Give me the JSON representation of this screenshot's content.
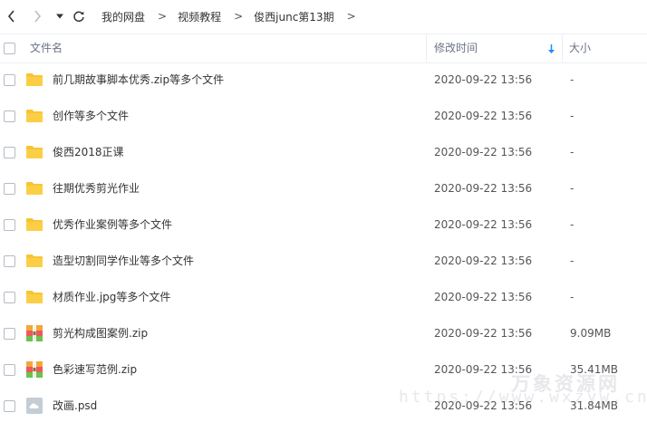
{
  "breadcrumb": [
    "我的网盘",
    "视频教程",
    "俊西junc第13期"
  ],
  "header": {
    "name": "文件名",
    "modified": "修改时间",
    "size": "大小"
  },
  "colors": {
    "folder": "#f9c433",
    "zip": "multicolor",
    "psd": "#c4ccd6",
    "sort_arrow": "#1a8cff"
  },
  "files": [
    {
      "name": "前几期故事脚本优秀.zip等多个文件",
      "time": "2020-09-22 13:56",
      "size": "-",
      "type": "folder",
      "icon": "folder-icon"
    },
    {
      "name": "创作等多个文件",
      "time": "2020-09-22 13:56",
      "size": "-",
      "type": "folder",
      "icon": "folder-icon"
    },
    {
      "name": "俊西2018正课",
      "time": "2020-09-22 13:56",
      "size": "-",
      "type": "folder",
      "icon": "folder-icon"
    },
    {
      "name": "往期优秀剪光作业",
      "time": "2020-09-22 13:56",
      "size": "-",
      "type": "folder",
      "icon": "folder-icon"
    },
    {
      "name": "优秀作业案例等多个文件",
      "time": "2020-09-22 13:56",
      "size": "-",
      "type": "folder",
      "icon": "folder-icon"
    },
    {
      "name": "造型切割同学作业等多个文件",
      "time": "2020-09-22 13:56",
      "size": "-",
      "type": "folder",
      "icon": "folder-icon"
    },
    {
      "name": "材质作业.jpg等多个文件",
      "time": "2020-09-22 13:56",
      "size": "-",
      "type": "folder",
      "icon": "folder-icon"
    },
    {
      "name": "剪光构成图案例.zip",
      "time": "2020-09-22 13:56",
      "size": "9.09MB",
      "type": "zip",
      "icon": "zip-archive-icon"
    },
    {
      "name": "色彩速写范例.zip",
      "time": "2020-09-22 13:56",
      "size": "35.41MB",
      "type": "zip",
      "icon": "zip-archive-icon"
    },
    {
      "name": "改画.psd",
      "time": "2020-09-22 13:56",
      "size": "31.84MB",
      "type": "psd",
      "icon": "psd-file-icon"
    }
  ],
  "watermark": {
    "text_cn": "万象资源网",
    "url": "https://www.wxzyw.cn"
  }
}
